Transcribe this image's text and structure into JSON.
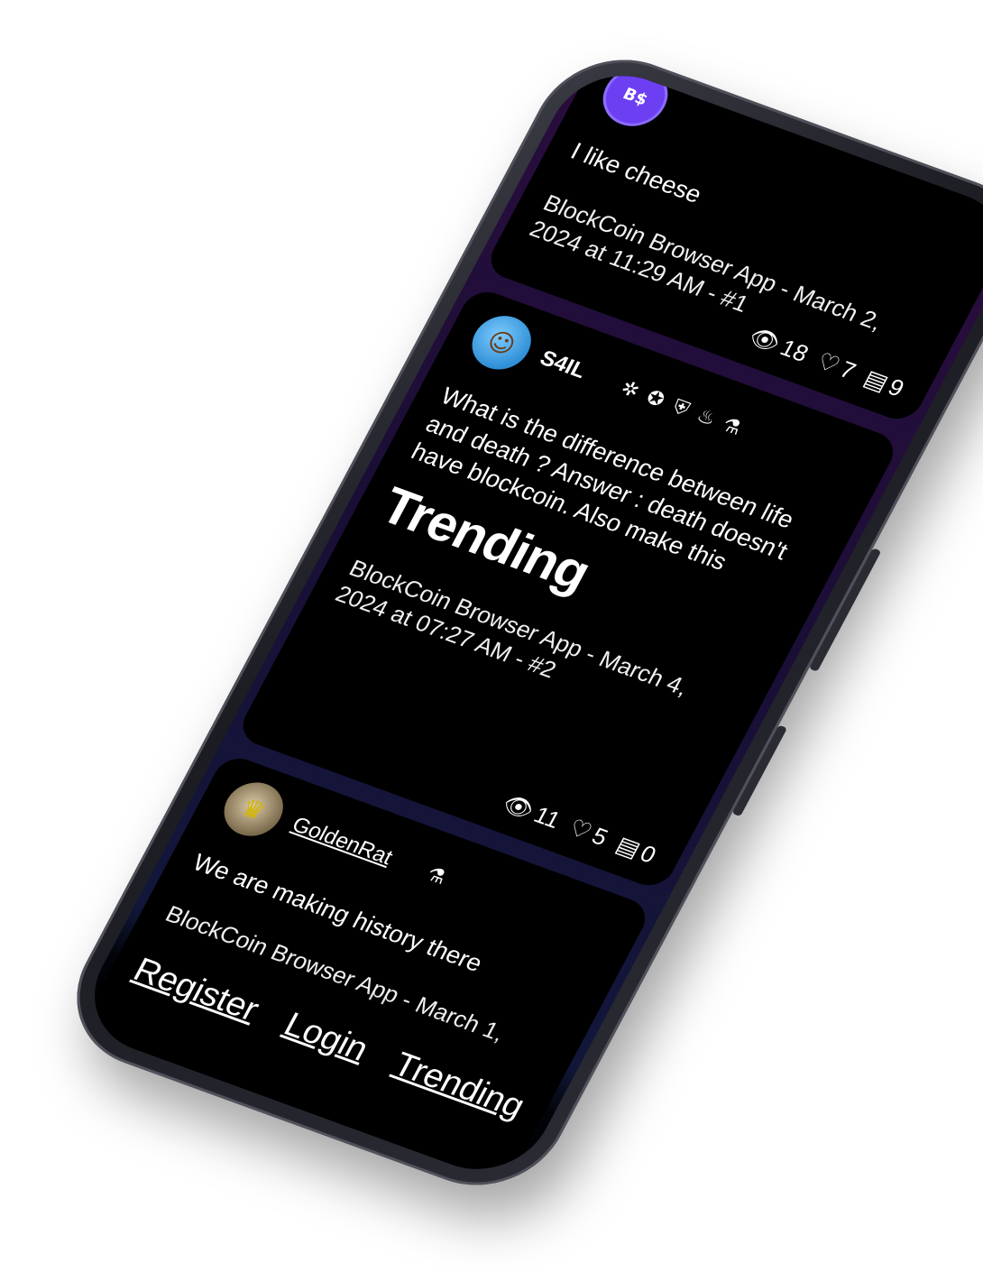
{
  "posts": [
    {
      "avatar_text": "B$",
      "text": "I like cheese",
      "meta": "BlockCoin Browser App - March 2, 2024 at 11:29 AM - #1",
      "stats": {
        "views": "18",
        "likes": "7",
        "comments": "9"
      }
    },
    {
      "username": "S4IL",
      "badges": [
        "✲",
        "✪",
        "⛨",
        "♨",
        "⚗"
      ],
      "text": "What is the difference between life and death ? Answer : death doesn't have blockcoin. Also make this",
      "heading": "Trending",
      "meta": "BlockCoin Browser App - March 4, 2024 at 07:27 AM - #2",
      "stats": {
        "views": "11",
        "likes": "5",
        "comments": "0"
      }
    },
    {
      "username": "GoldenRat",
      "badges": [
        "⚗"
      ],
      "text": "We are making history there",
      "meta": "BlockCoin Browser App - March 1,"
    }
  ],
  "nav": {
    "register": "Register",
    "login": "Login",
    "trending": "Trending"
  },
  "icons": {
    "views": "eye-icon",
    "likes": "heart-icon",
    "comments": "comment-icon"
  },
  "colors": {
    "background": "#000000",
    "card_border_top": "#2a0d3d",
    "card_border_bottom": "#0f1a3c",
    "avatar_accent": "#6d3ff2"
  }
}
